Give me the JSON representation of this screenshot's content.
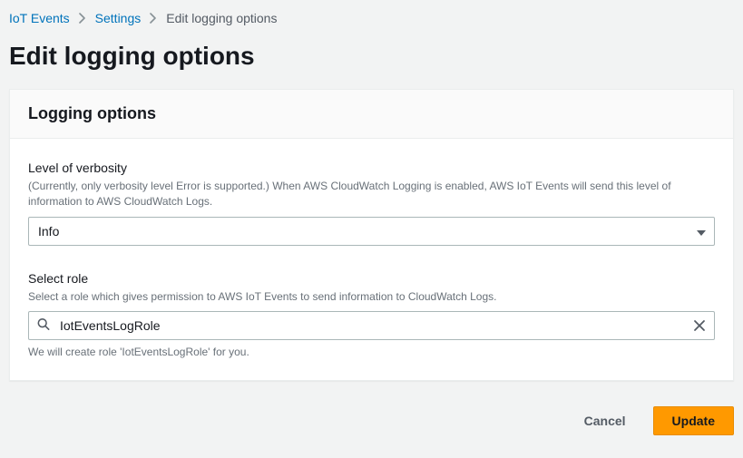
{
  "breadcrumbs": {
    "items": [
      {
        "label": "IoT Events"
      },
      {
        "label": "Settings"
      }
    ],
    "current": "Edit logging options"
  },
  "page": {
    "title": "Edit logging options"
  },
  "panel": {
    "title": "Logging options"
  },
  "fields": {
    "verbosity": {
      "label": "Level of verbosity",
      "description": "(Currently, only verbosity level Error is supported.) When AWS CloudWatch Logging is enabled, AWS IoT Events will send this level of information to AWS CloudWatch Logs.",
      "value": "Info"
    },
    "role": {
      "label": "Select role",
      "description": "Select a role which gives permission to AWS IoT Events to send information to CloudWatch Logs.",
      "value": "IotEventsLogRole",
      "hint": "We will create role 'IotEventsLogRole' for you."
    }
  },
  "actions": {
    "cancel": "Cancel",
    "update": "Update"
  }
}
